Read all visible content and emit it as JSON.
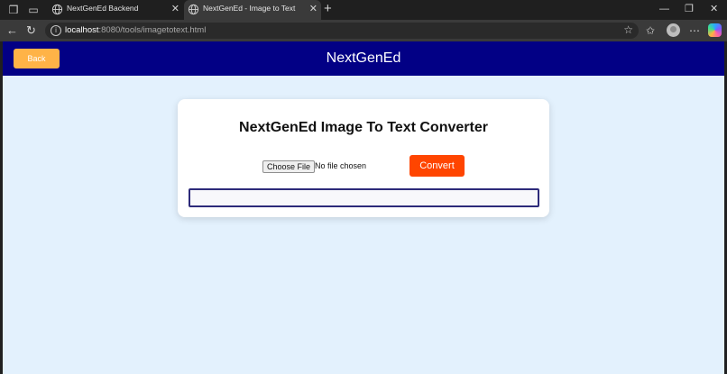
{
  "browser": {
    "tabs": [
      {
        "title": "NextGenEd Backend",
        "active": false
      },
      {
        "title": "NextGenEd - Image to Text",
        "active": true
      }
    ],
    "url": {
      "host": "localhost",
      "rest": ":8080/tools/imagetotext.html"
    }
  },
  "header": {
    "back_label": "Back",
    "brand": "NextGenEd"
  },
  "converter": {
    "title": "NextGenEd Image To Text Converter",
    "choose_file_label": "Choose File",
    "file_status": "No file chosen",
    "convert_label": "Convert",
    "output_text": ""
  },
  "colors": {
    "header_bg": "#020085",
    "page_bg": "#e3f1fd",
    "back_button": "#ffb347",
    "convert_button": "#ff4500",
    "output_border": "#2d2a7a"
  },
  "icons": [
    "workspaces-icon",
    "tab-actions-icon",
    "globe-icon",
    "close-icon",
    "new-tab-icon",
    "minimize-icon",
    "restore-icon",
    "back-arrow-icon",
    "refresh-icon",
    "site-info-icon",
    "favorite-star-icon",
    "favorites-icon",
    "profile-avatar",
    "more-icon",
    "copilot-icon"
  ]
}
